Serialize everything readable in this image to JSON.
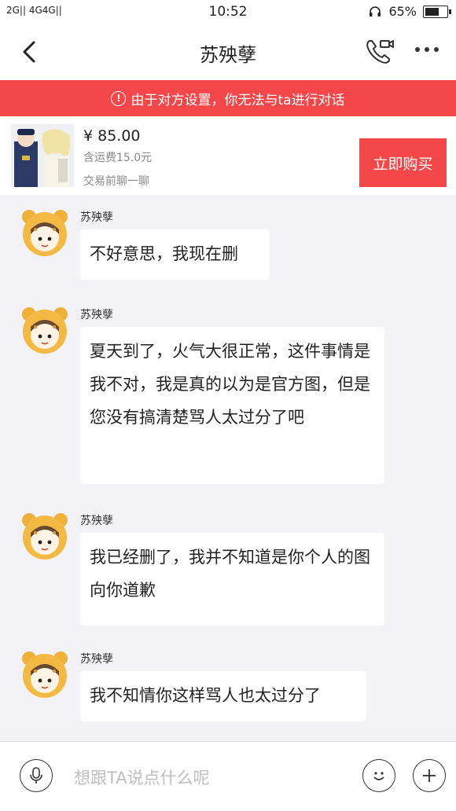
{
  "status_bar": {
    "signal_text": "2G|| 4G4G||",
    "time": "10:52",
    "battery": "65%",
    "battery_level": 0.65
  },
  "nav": {
    "title": "苏殃孽"
  },
  "banner": {
    "text": "由于对方设置，你无法与ta进行对话",
    "icon": "!"
  },
  "product": {
    "price": "¥ 85.00",
    "shipping": "含运费15.0元",
    "chat_hint": "交易前聊一聊",
    "buy_label": "立即购买"
  },
  "messages": [
    {
      "sender": "苏殃孽",
      "text": "不好意思，我现在删"
    },
    {
      "sender": "苏殃孽",
      "text": "夏天到了，火气大很正常，这件事情是我不对，我是真的以为是官方图，但是您没有搞清楚骂人太过分了吧"
    },
    {
      "sender": "苏殃孽",
      "text": "我已经删了，我并不知道是你个人的图向你道歉"
    },
    {
      "sender": "苏殃孽",
      "text": "我不知情你这样骂人也太过分了"
    }
  ],
  "input": {
    "placeholder": "想跟TA说点什么呢"
  },
  "colors": {
    "accent": "#f3474a",
    "background": "#f3f3f7"
  }
}
